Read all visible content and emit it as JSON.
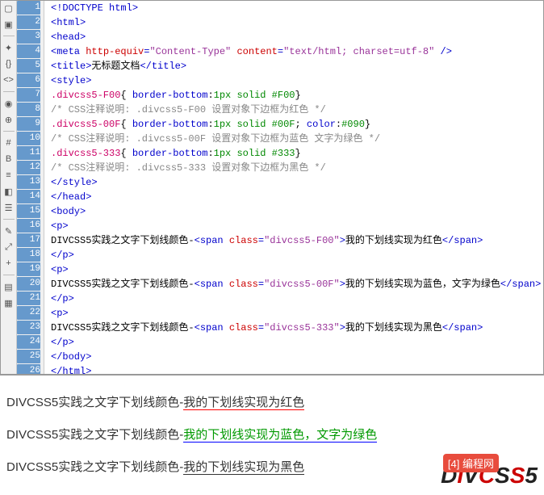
{
  "toolbar_icons": [
    "file-icon",
    "folder-icon",
    "sep",
    "wand-icon",
    "braces-icon",
    "tag-icon",
    "sep",
    "eye-icon",
    "target-icon",
    "sep",
    "anchor-icon",
    "bold-icon",
    "align-icon",
    "paint-icon",
    "list-icon",
    "sep",
    "comment-icon",
    "expand-icon",
    "add-icon",
    "sep",
    "layers-icon",
    "ruler-icon"
  ],
  "lines": [
    {
      "n": "1",
      "parts": [
        {
          "c": "tag",
          "t": "<!DOCTYPE html>"
        }
      ]
    },
    {
      "n": "2",
      "parts": [
        {
          "c": "tag",
          "t": "<html>"
        }
      ]
    },
    {
      "n": "3",
      "parts": [
        {
          "c": "tag",
          "t": "<head>"
        }
      ]
    },
    {
      "n": "4",
      "parts": [
        {
          "c": "tag",
          "t": "<meta "
        },
        {
          "c": "attr",
          "t": "http-equiv"
        },
        {
          "c": "tag",
          "t": "="
        },
        {
          "c": "val",
          "t": "\"Content-Type\""
        },
        {
          "c": "tag",
          "t": " "
        },
        {
          "c": "attr",
          "t": "content"
        },
        {
          "c": "tag",
          "t": "="
        },
        {
          "c": "val",
          "t": "\"text/html; charset=utf-8\""
        },
        {
          "c": "tag",
          "t": " />"
        }
      ]
    },
    {
      "n": "5",
      "parts": [
        {
          "c": "tag",
          "t": "<title>"
        },
        {
          "c": "txt",
          "t": "无标题文档"
        },
        {
          "c": "tag",
          "t": "</title>"
        }
      ]
    },
    {
      "n": "6",
      "parts": [
        {
          "c": "tag",
          "t": "<style>"
        }
      ]
    },
    {
      "n": "7",
      "parts": [
        {
          "c": "sel",
          "t": ".divcss5-F00"
        },
        {
          "c": "txt",
          "t": "{ "
        },
        {
          "c": "prop",
          "t": "border-bottom"
        },
        {
          "c": "txt",
          "t": ":"
        },
        {
          "c": "str",
          "t": "1px solid #F00"
        },
        {
          "c": "txt",
          "t": "}"
        }
      ]
    },
    {
      "n": "8",
      "parts": [
        {
          "c": "comment",
          "t": "/* CSS注释说明: .divcss5-F00 设置对象下边框为红色 */"
        }
      ]
    },
    {
      "n": "9",
      "parts": [
        {
          "c": "sel",
          "t": ".divcss5-00F"
        },
        {
          "c": "txt",
          "t": "{ "
        },
        {
          "c": "prop",
          "t": "border-bottom"
        },
        {
          "c": "txt",
          "t": ":"
        },
        {
          "c": "str",
          "t": "1px solid #00F"
        },
        {
          "c": "txt",
          "t": "; "
        },
        {
          "c": "prop",
          "t": "color"
        },
        {
          "c": "txt",
          "t": ":"
        },
        {
          "c": "str",
          "t": "#090"
        },
        {
          "c": "txt",
          "t": "}"
        }
      ]
    },
    {
      "n": "10",
      "parts": [
        {
          "c": "comment",
          "t": "/* CSS注释说明: .divcss5-00F 设置对象下边框为蓝色 文字为绿色 */"
        }
      ]
    },
    {
      "n": "11",
      "parts": [
        {
          "c": "sel",
          "t": ".divcss5-333"
        },
        {
          "c": "txt",
          "t": "{ "
        },
        {
          "c": "prop",
          "t": "border-bottom"
        },
        {
          "c": "txt",
          "t": ":"
        },
        {
          "c": "str",
          "t": "1px solid #333"
        },
        {
          "c": "txt",
          "t": "}"
        }
      ]
    },
    {
      "n": "12",
      "parts": [
        {
          "c": "comment",
          "t": "/* CSS注释说明: .divcss5-333 设置对象下边框为黑色 */"
        }
      ]
    },
    {
      "n": "13",
      "parts": [
        {
          "c": "tag",
          "t": "</style>"
        }
      ]
    },
    {
      "n": "14",
      "parts": [
        {
          "c": "tag",
          "t": "</head>"
        }
      ]
    },
    {
      "n": "15",
      "parts": [
        {
          "c": "tag",
          "t": "<body>"
        }
      ]
    },
    {
      "n": "16",
      "parts": [
        {
          "c": "tag",
          "t": "<p>"
        }
      ]
    },
    {
      "n": "17",
      "parts": [
        {
          "c": "txt",
          "t": "DIVCSS5实践之文字下划线颜色-"
        },
        {
          "c": "tag",
          "t": "<span "
        },
        {
          "c": "attr",
          "t": "class"
        },
        {
          "c": "tag",
          "t": "="
        },
        {
          "c": "val",
          "t": "\"divcss5-F00\""
        },
        {
          "c": "tag",
          "t": ">"
        },
        {
          "c": "txt",
          "t": "我的下划线实现为红色"
        },
        {
          "c": "tag",
          "t": "</span>"
        }
      ]
    },
    {
      "n": "18",
      "parts": [
        {
          "c": "tag",
          "t": "</p>"
        }
      ]
    },
    {
      "n": "19",
      "parts": [
        {
          "c": "tag",
          "t": "<p>"
        }
      ]
    },
    {
      "n": "20",
      "parts": [
        {
          "c": "txt",
          "t": "DIVCSS5实践之文字下划线颜色-"
        },
        {
          "c": "tag",
          "t": "<span "
        },
        {
          "c": "attr",
          "t": "class"
        },
        {
          "c": "tag",
          "t": "="
        },
        {
          "c": "val",
          "t": "\"divcss5-00F\""
        },
        {
          "c": "tag",
          "t": ">"
        },
        {
          "c": "txt",
          "t": "我的下划线实现为蓝色，文字为绿色"
        },
        {
          "c": "tag",
          "t": "</span>"
        }
      ]
    },
    {
      "n": "21",
      "parts": [
        {
          "c": "tag",
          "t": "</p>"
        }
      ]
    },
    {
      "n": "22",
      "parts": [
        {
          "c": "tag",
          "t": "<p>"
        }
      ]
    },
    {
      "n": "23",
      "parts": [
        {
          "c": "txt",
          "t": "DIVCSS5实践之文字下划线颜色-"
        },
        {
          "c": "tag",
          "t": "<span "
        },
        {
          "c": "attr",
          "t": "class"
        },
        {
          "c": "tag",
          "t": "="
        },
        {
          "c": "val",
          "t": "\"divcss5-333\""
        },
        {
          "c": "tag",
          "t": ">"
        },
        {
          "c": "txt",
          "t": "我的下划线实现为黑色"
        },
        {
          "c": "tag",
          "t": "</span>"
        }
      ]
    },
    {
      "n": "24",
      "parts": [
        {
          "c": "tag",
          "t": "</p>"
        }
      ]
    },
    {
      "n": "25",
      "parts": [
        {
          "c": "tag",
          "t": "</body>"
        }
      ]
    },
    {
      "n": "26",
      "parts": [
        {
          "c": "tag",
          "t": "</html>"
        }
      ]
    }
  ],
  "preview": {
    "p1_prefix": "DIVCSS5实践之文字下划线颜色-",
    "p1_span": "我的下划线实现为红色",
    "p2_prefix": "DIVCSS5实践之文字下划线颜色-",
    "p2_span": "我的下划线实现为蓝色，文字为绿色",
    "p3_prefix": "DIVCSS5实践之文字下划线颜色-",
    "p3_span": "我的下划线实现为黑色"
  },
  "watermark": {
    "text": "DIVCSS5",
    "badge": "[4]",
    "sub": "编程网"
  }
}
